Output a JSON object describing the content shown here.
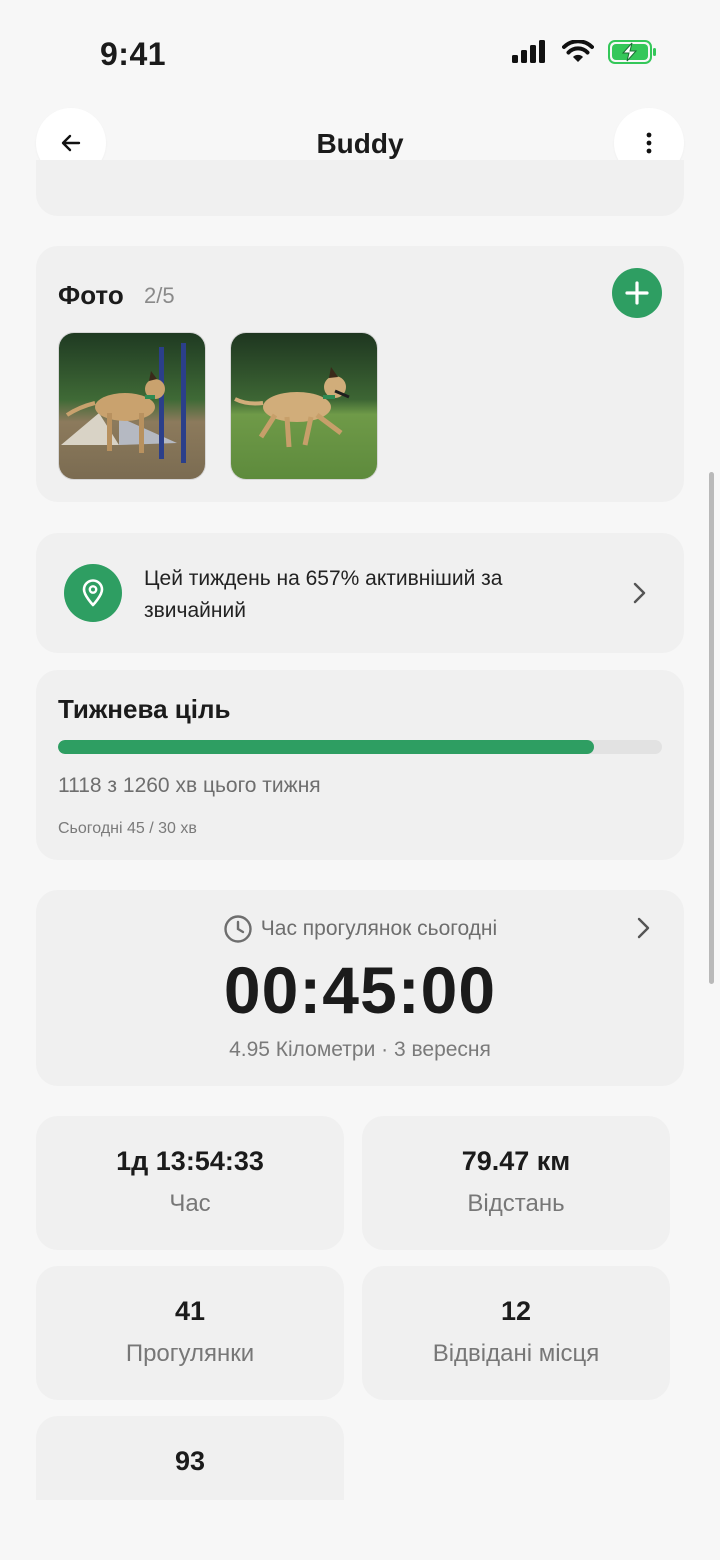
{
  "status_bar": {
    "time": "9:41"
  },
  "header": {
    "title": "Buddy"
  },
  "photos": {
    "title": "Фото",
    "count": "2/5"
  },
  "insight": {
    "text": "Цей тиждень на 657% активніший за звичайний"
  },
  "weekly_goal": {
    "title": "Тижнева ціль",
    "progress_fraction": 0.887,
    "summary": "1118 з 1260 хв цього тижня",
    "today": "Сьогодні 45 / 30 хв"
  },
  "walk_today": {
    "label": "Час прогулянок сьогодні",
    "time": "00:45:00",
    "subtitle": "4.95 Кілометри · 3 вересня"
  },
  "stats": [
    {
      "value": "1д 13:54:33",
      "label": "Час"
    },
    {
      "value": "79.47 км",
      "label": "Відстань"
    },
    {
      "value": "41",
      "label": "Прогулянки"
    },
    {
      "value": "12",
      "label": "Відвідані місця"
    },
    {
      "value": "93",
      "label": ""
    }
  ],
  "colors": {
    "accent": "#2e9e62",
    "card": "#f0f0f0",
    "background": "#f7f7f7"
  },
  "icons": [
    "back-arrow-icon",
    "more-vertical-icon",
    "plus-icon",
    "location-pin-icon",
    "chevron-right-icon",
    "clock-icon",
    "cellular-signal-icon",
    "wifi-icon",
    "battery-charging-icon"
  ]
}
